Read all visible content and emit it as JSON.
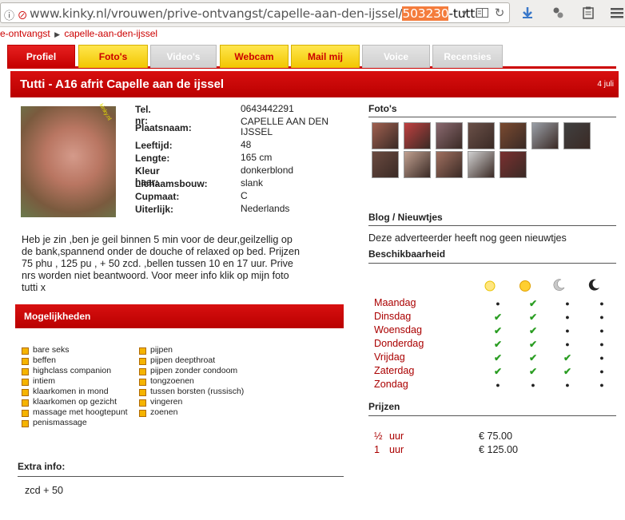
{
  "browser": {
    "url_prefix": "www.kinky.nl/vrouwen/prive-ontvangst/capelle-aan-den-ijssel/",
    "url_highlight": "503230",
    "url_suffix": "-tutti",
    "lead_icons": "i ⊘"
  },
  "breadcrumb": {
    "items": [
      "e-ontvangst",
      "capelle-aan-den-ijssel"
    ]
  },
  "tabs": [
    {
      "label": "Profiel",
      "style": "red"
    },
    {
      "label": "Foto's",
      "style": "yellow"
    },
    {
      "label": "Video's",
      "style": "grey"
    },
    {
      "label": "Webcam",
      "style": "yellow"
    },
    {
      "label": "Mail mij",
      "style": "yellow"
    },
    {
      "label": "Voice",
      "style": "grey"
    },
    {
      "label": "Recensies",
      "style": "grey"
    }
  ],
  "title": {
    "text": "Tutti - A16 afrit Capelle aan de ijssel",
    "date": "4 juli"
  },
  "photo": {
    "watermark": "kinky.nl"
  },
  "details": [
    {
      "label": "Tel. nr:",
      "value": "0643442291"
    },
    {
      "label": "Plaatsnaam:",
      "value": "CAPELLE AAN DEN IJSSEL"
    },
    {
      "label": "Leeftijd:",
      "value": "48"
    },
    {
      "label": "Lengte:",
      "value": "165 cm"
    },
    {
      "label": "Kleur haar:",
      "value": "donkerblond"
    },
    {
      "label": "Lichaamsbouw:",
      "value": "slank"
    },
    {
      "label": "Cupmaat:",
      "value": "C"
    },
    {
      "label": "Uiterlijk:",
      "value": "Nederlands"
    }
  ],
  "description": [
    "Heb je zin ,ben je geil binnen 5 min voor de deur,geilzellig op",
    "de bank,spannend onder de douche of relaxed op bed. Prijzen",
    "75 phu , 125 pu , + 50 zcd. ,bellen tussen 10 en 17 uur. Prive",
    "nrs worden niet beantwoord. Voor meer info klik op mijn foto",
    "tutti x"
  ],
  "mogelijkheden": {
    "heading": "Mogelijkheden",
    "col1": [
      "bare seks",
      "beffen",
      "highclass companion",
      "intiem",
      "klaarkomen in mond",
      "klaarkomen op gezicht",
      "massage met hoogtepunt",
      "penismassage"
    ],
    "col2": [
      "pijpen",
      "pijpen deepthroat",
      "pijpen zonder condoom",
      "tongzoenen",
      "tussen borsten (russisch)",
      "vingeren",
      "zoenen"
    ]
  },
  "extra": {
    "heading": "Extra info:",
    "value": "zcd + 50"
  },
  "right": {
    "photos_heading": "Foto's",
    "photo_colors": [
      "#a06050",
      "#c04040",
      "#8a6a70",
      "#6a5048",
      "#7a4a30",
      "#9aa0a8",
      "#404040",
      "#6a4a40",
      "#c0a090",
      "#a07060",
      "#d0d0d0",
      "#7a3030"
    ],
    "blog_heading": "Blog / Nieuwtjes",
    "blog_text": "Deze adverteerder heeft nog geen nieuwtjes",
    "beschik_heading": "Beschikbaarheid",
    "days": [
      {
        "name": "Maandag",
        "slots": [
          false,
          true,
          false,
          false
        ]
      },
      {
        "name": "Dinsdag",
        "slots": [
          true,
          true,
          false,
          false
        ]
      },
      {
        "name": "Woensdag",
        "slots": [
          true,
          true,
          false,
          false
        ]
      },
      {
        "name": "Donderdag",
        "slots": [
          true,
          true,
          false,
          false
        ]
      },
      {
        "name": "Vrijdag",
        "slots": [
          true,
          true,
          true,
          false
        ]
      },
      {
        "name": "Zaterdag",
        "slots": [
          true,
          true,
          true,
          false
        ]
      },
      {
        "name": "Zondag",
        "slots": [
          false,
          false,
          false,
          false
        ]
      }
    ],
    "prices_heading": "Prijzen",
    "prices": [
      {
        "qty": "½",
        "unit": "uur",
        "amount": "€ 75.00"
      },
      {
        "qty": "1",
        "unit": "uur",
        "amount": "€ 125.00"
      }
    ]
  }
}
